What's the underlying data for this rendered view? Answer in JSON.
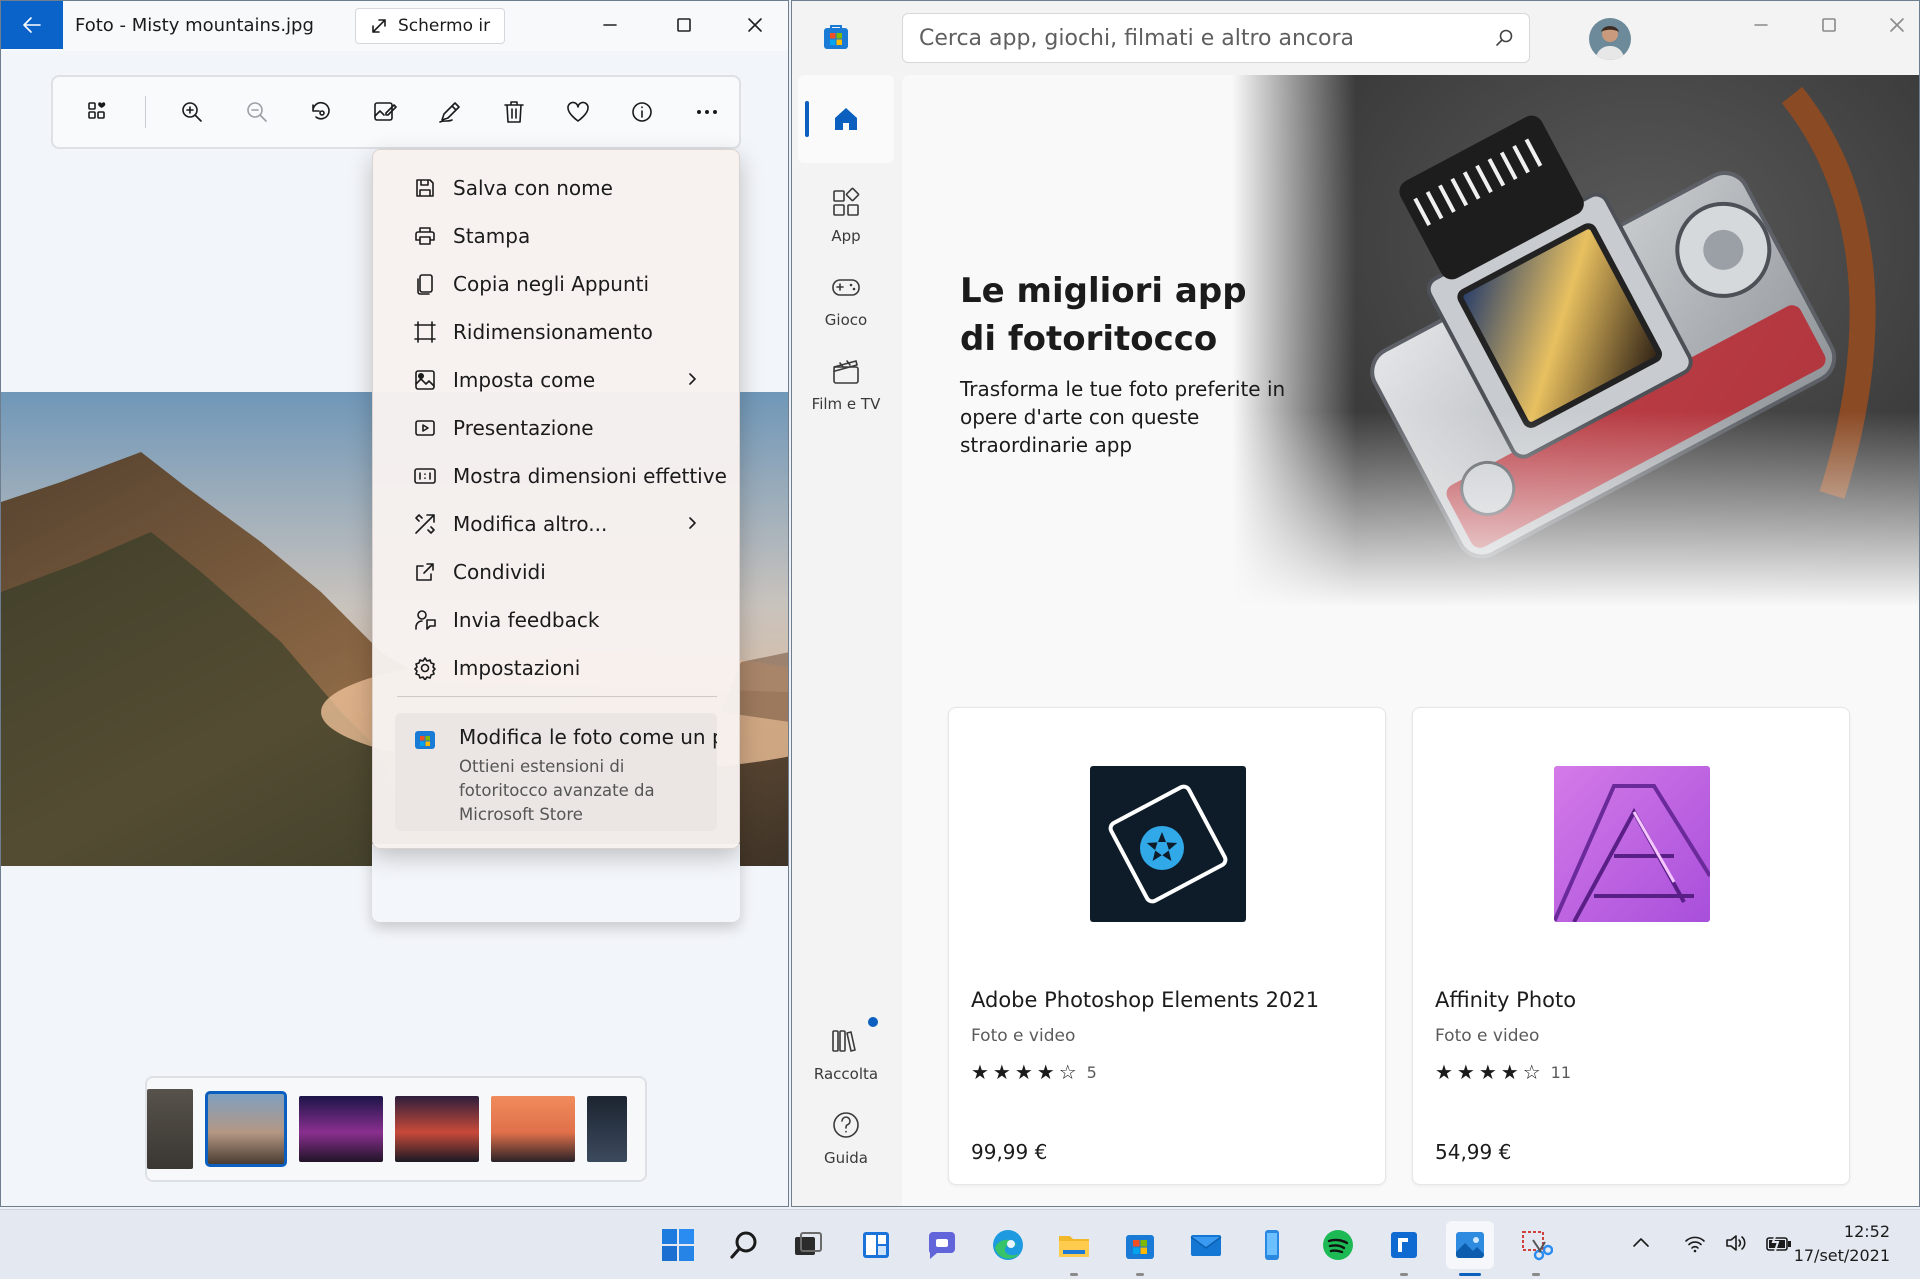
{
  "photos": {
    "title": "Foto - Misty mountains.jpg",
    "screen_button": "Schermo ir",
    "toolbar": [
      "add-to-album",
      "zoom-in",
      "zoom-out",
      "rotate",
      "edit-image",
      "draw",
      "delete",
      "favorite",
      "info",
      "more"
    ],
    "menu": {
      "items": [
        {
          "label": "Salva con nome",
          "icon": "save-icon",
          "submenu": false
        },
        {
          "label": "Stampa",
          "icon": "print-icon",
          "submenu": false
        },
        {
          "label": "Copia negli Appunti",
          "icon": "copy-icon",
          "submenu": false
        },
        {
          "label": "Ridimensionamento",
          "icon": "resize-icon",
          "submenu": false
        },
        {
          "label": "Imposta come",
          "icon": "set-as-icon",
          "submenu": true
        },
        {
          "label": "Presentazione",
          "icon": "slideshow-icon",
          "submenu": false
        },
        {
          "label": "Mostra dimensioni effettive",
          "icon": "actual-size-icon",
          "submenu": false
        },
        {
          "label": "Modifica altro...",
          "icon": "edit-more-icon",
          "submenu": true
        },
        {
          "label": "Condividi",
          "icon": "share-icon",
          "submenu": false
        },
        {
          "label": "Invia feedback",
          "icon": "feedback-icon",
          "submenu": false
        },
        {
          "label": "Impostazioni",
          "icon": "settings-icon",
          "submenu": false
        }
      ],
      "promo": {
        "title": "Modifica le foto come un p",
        "description": "Ottieni estensioni di fotoritocco avanzate da Microsoft Store"
      }
    }
  },
  "store": {
    "search_placeholder": "Cerca app, giochi, filmati e altro ancora",
    "nav": {
      "app": "App",
      "gioco": "Gioco",
      "film": "Film e TV",
      "raccolta": "Raccolta",
      "guida": "Guida"
    },
    "hero": {
      "title": "Le migliori app di fotoritocco",
      "subtitle": "Trasforma le tue foto preferite in opere d'arte con queste straordinarie app"
    },
    "cards": [
      {
        "name": "Adobe Photoshop Elements 2021",
        "category": "Foto e video",
        "rating": 4,
        "rating_count": "5",
        "price": "99,99 €"
      },
      {
        "name": "Affinity Photo",
        "category": "Foto e video",
        "rating": 4,
        "rating_count": "11",
        "price": "54,99 €"
      }
    ]
  },
  "taskbar": {
    "time": "12:52",
    "date": "17/set/2021"
  },
  "colors": {
    "accent": "#0a5fbf",
    "back_button": "#0a63c9"
  }
}
